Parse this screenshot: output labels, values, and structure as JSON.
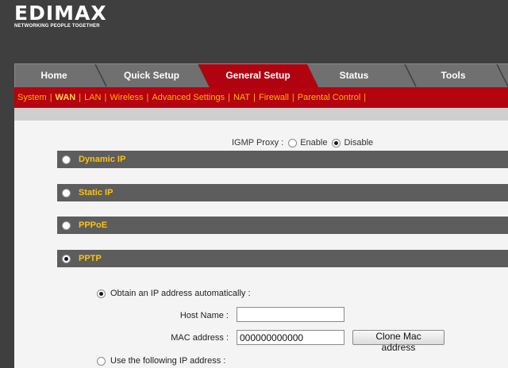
{
  "brand": {
    "logo_text": "EDIMAX",
    "tagline": "NETWORKING PEOPLE TOGETHER"
  },
  "tabs": [
    {
      "label": "Home",
      "active": false
    },
    {
      "label": "Quick Setup",
      "active": false
    },
    {
      "label": "General Setup",
      "active": true
    },
    {
      "label": "Status",
      "active": false
    },
    {
      "label": "Tools",
      "active": false
    }
  ],
  "subnav": {
    "items": [
      "System",
      "WAN",
      "LAN",
      "Wireless",
      "Advanced Settings",
      "NAT",
      "Firewall",
      "Parental Control"
    ],
    "active": "WAN",
    "separator": "|"
  },
  "igmp": {
    "label": "IGMP Proxy :",
    "enable_label": "Enable",
    "disable_label": "Disable",
    "selected": "Disable"
  },
  "connection_types": [
    {
      "label": "Dynamic IP",
      "selected": false
    },
    {
      "label": "Static IP",
      "selected": false
    },
    {
      "label": "PPPoE",
      "selected": false
    },
    {
      "label": "PPTP",
      "selected": true
    }
  ],
  "pptp": {
    "obtain_auto_label": "Obtain an IP address automatically :",
    "obtain_auto_selected": true,
    "host_name_label": "Host Name :",
    "host_name_value": "",
    "mac_label": "MAC address :",
    "mac_value": "000000000000",
    "clone_mac_button": "Clone Mac address",
    "use_following_label": "Use the following IP address :",
    "use_following_selected": false
  },
  "colors": {
    "accent_red": "#b1020f",
    "menu_yellow": "#ffb300",
    "section_label": "#ffc20e",
    "bar_gray": "#5d5d5d"
  }
}
